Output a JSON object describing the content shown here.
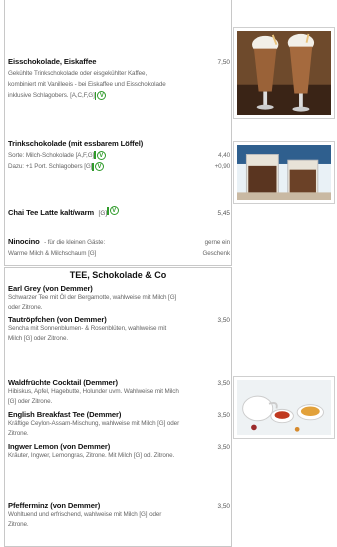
{
  "top": {
    "item1": {
      "name": "Eisschokolade, Eiskaffee",
      "price": "7,50",
      "desc_lines": [
        "Gekühlte Trinkschokolade oder eisgekühlter Kaffee,",
        "kombiniert mit Vanilleeis - bei Eiskaffee und Eisschokolade",
        "inklusive Schlagobers. [A,C,F,G]"
      ]
    },
    "item2": {
      "name": "Trinkschokolade (mit essbarem Löffel)",
      "line1": "Sorte: Milch-Schokolade [A,F,G]",
      "line1_price": "4,40",
      "line2": "Dazu: +1 Port. Schlagobers [G]",
      "line2_price": "+0,90"
    },
    "item3": {
      "name": "Chai Tee Latte kalt/warm",
      "allergen": "[G]",
      "price": "5,45"
    },
    "item4": {
      "name": "Ninocino",
      "line1": "- für die kleinen Gäste:",
      "line1_right": "gerne ein",
      "line2": "Warme Milch & Milchschaum [G]",
      "line2_right": "Geschenk"
    }
  },
  "veg_symbol": "V",
  "bottom": {
    "title": "TEE, Schokolade & Co",
    "items": [
      {
        "name": "Earl Grey (von Demmer)",
        "price": "",
        "lines": [
          "Schwarzer Tee mit Öl der Bergamotte, wahlweise mit Milch [G]",
          "oder Zitrone."
        ]
      },
      {
        "name": "Tautröpfchen (von Demmer)",
        "price": "3,50",
        "lines": [
          "Sencha mit Sonnenblumen- & Rosenblüten, wahlweise mit",
          "Milch [G] oder Zitrone."
        ]
      },
      {
        "name": "Waldfrüchte Cocktail (Demmer)",
        "price": "3,50",
        "lines": [
          "Hibiskus, Apfel, Hagebutte, Holunder uvm. Wahlweise mit Milch",
          "[G] oder Zitrone."
        ]
      },
      {
        "name": "English Breakfast Tee (Demmer)",
        "price": "3,50",
        "lines": [
          "Kräftige Ceylon-Assam-Mischung, wahlweise mit Milch [G] oder",
          "Zitrone."
        ]
      },
      {
        "name": "Ingwer Lemon (von Demmer)",
        "price": "3,50",
        "lines": [
          "Kräuter, Ingwer, Lemongras, Zitrone. Mit Milch [G] od. Zitrone."
        ]
      },
      {
        "name": "Pfefferminz (von Demmer)",
        "price": "3,50",
        "lines": [
          "Wohltuend und erfrischend, wahlweise mit Milch [G] oder",
          "Zitrone."
        ]
      }
    ]
  },
  "colors": {
    "veg_green": "#2f9a2a",
    "border": "#c8c8c8"
  }
}
